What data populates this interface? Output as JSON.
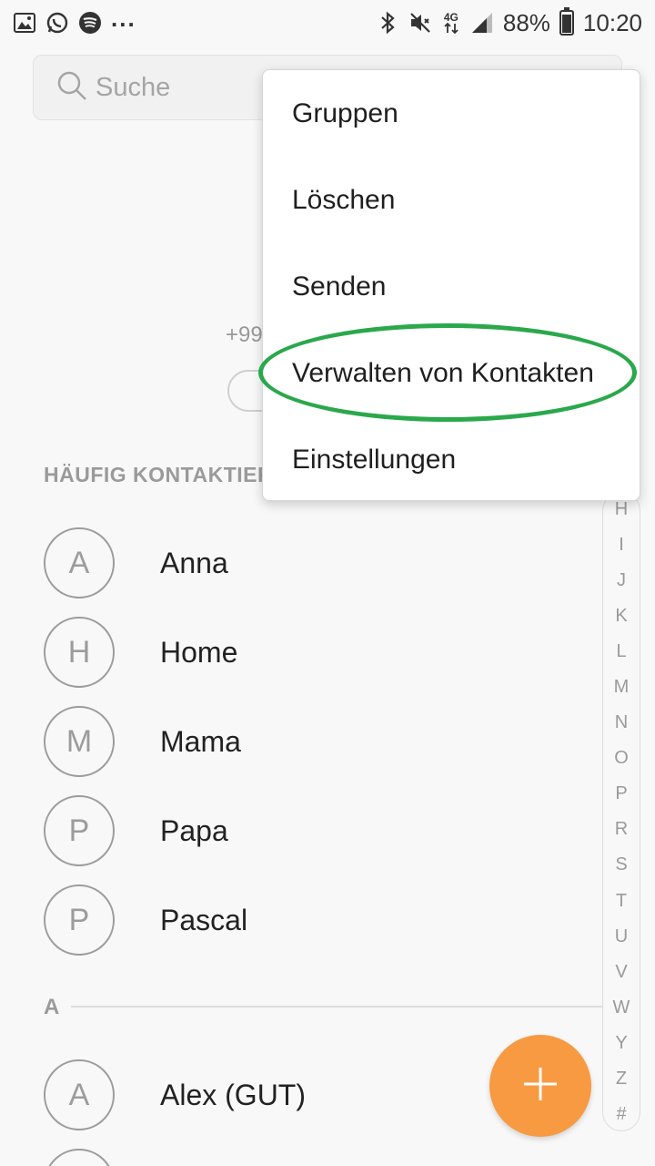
{
  "status_bar": {
    "battery": "88%",
    "network": "4G",
    "time": "10:20",
    "more": "...",
    "left_icons": [
      "image-icon",
      "whatsapp-icon",
      "spotify-icon"
    ],
    "right_icons": [
      "bluetooth-icon",
      "mute-icon",
      "network-icon",
      "signal-icon",
      "battery-icon"
    ]
  },
  "search": {
    "placeholder": "Suche"
  },
  "profile": {
    "phone_partial": "+99"
  },
  "frequent": {
    "title": "HÄUFIG KONTAKTIERT",
    "contacts": [
      {
        "initial": "A",
        "name": "Anna"
      },
      {
        "initial": "H",
        "name": "Home"
      },
      {
        "initial": "M",
        "name": "Mama"
      },
      {
        "initial": "P",
        "name": "Papa"
      },
      {
        "initial": "P",
        "name": "Pascal"
      }
    ]
  },
  "section_a": {
    "letter": "A",
    "contacts": [
      {
        "initial": "A",
        "name": "Alex (GUT)"
      }
    ]
  },
  "index_letters": [
    "H",
    "I",
    "J",
    "K",
    "L",
    "M",
    "N",
    "O",
    "P",
    "R",
    "S",
    "T",
    "U",
    "V",
    "W",
    "Y",
    "Z",
    "#"
  ],
  "menu": {
    "items": [
      "Gruppen",
      "Löschen",
      "Senden",
      "Verwalten von Kontakten",
      "Einstellungen"
    ],
    "highlighted_item": "Verwalten von Kontakten"
  },
  "colors": {
    "fab": "#f79a42",
    "highlight": "#2aa84b",
    "background": "#f8f8f8"
  }
}
